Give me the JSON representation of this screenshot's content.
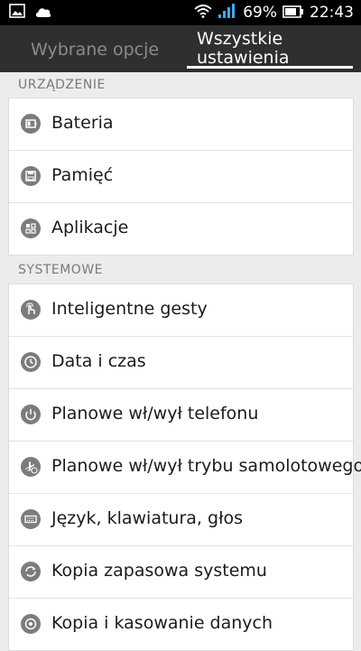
{
  "status_bar": {
    "battery_percent": "69%",
    "time": "22:43",
    "left_icons": [
      "image-icon",
      "cloud-icon"
    ],
    "right_icons": [
      "wifi-icon",
      "signal-icon",
      "battery-icon"
    ]
  },
  "tabs": [
    {
      "label": "Wybrane opcje",
      "selected": false
    },
    {
      "label": "Wszystkie\nustawienia",
      "selected": true
    }
  ],
  "sections": [
    {
      "header": "URZĄDZENIE",
      "items": [
        {
          "label": "Bateria",
          "icon": "battery-icon"
        },
        {
          "label": "Pamięć",
          "icon": "storage-icon"
        },
        {
          "label": "Aplikacje",
          "icon": "apps-icon"
        }
      ]
    },
    {
      "header": "SYSTEMOWE",
      "items": [
        {
          "label": "Inteligentne gesty",
          "icon": "gesture-hand-icon"
        },
        {
          "label": "Data i czas",
          "icon": "clock-icon"
        },
        {
          "label": "Planowe wł/wył telefonu",
          "icon": "power-icon"
        },
        {
          "label": "Planowe wł/wył trybu samolotowego",
          "icon": "airplane-clock-icon"
        },
        {
          "label": "Język, klawiatura, głos",
          "icon": "keyboard-icon"
        },
        {
          "label": "Kopia zapasowa systemu",
          "icon": "backup-sync-icon"
        },
        {
          "label": "Kopia i kasowanie danych",
          "icon": "reset-icon"
        }
      ]
    }
  ],
  "colors": {
    "status_bar_bg": "#000000",
    "tab_bar_bg": "#2f2f2f",
    "page_bg": "#ececec",
    "icon_bg": "#7c7c7c"
  }
}
